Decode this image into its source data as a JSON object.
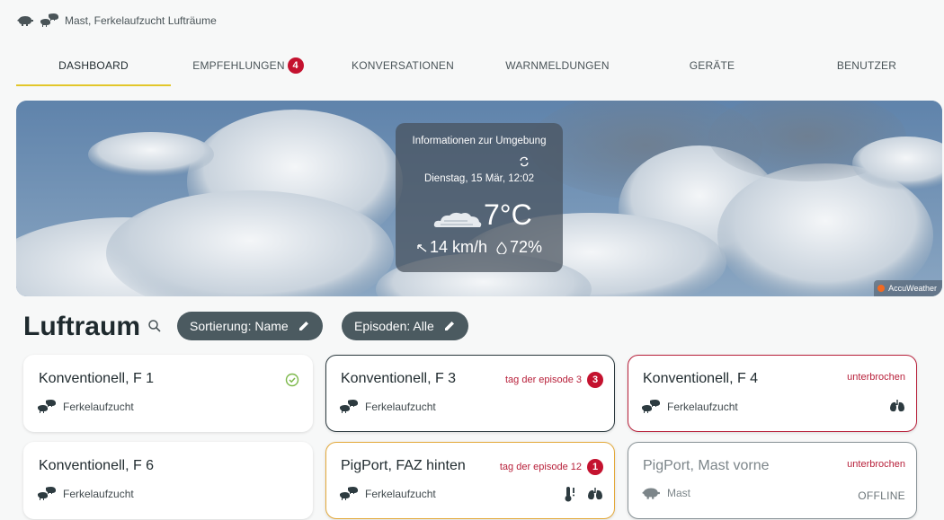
{
  "breadcrumb": {
    "text": "Mast, Ferkelaufzucht Lufträume"
  },
  "tabs": [
    {
      "label": "DASHBOARD",
      "active": true
    },
    {
      "label": "EMPFEHLUNGEN",
      "badge": "4"
    },
    {
      "label": "KONVERSATIONEN"
    },
    {
      "label": "WARNMELDUNGEN"
    },
    {
      "label": "GERÄTE"
    },
    {
      "label": "BENUTZER"
    }
  ],
  "weather": {
    "title": "Informationen zur Umgebung",
    "date": "Dienstag, 15 Mär, 12:02",
    "temperature": "7°C",
    "wind": "14 km/h",
    "humidity": "72%",
    "provider": "AccuWeather"
  },
  "section": {
    "title": "Luftraum",
    "sort_chip": "Sortierung: Name",
    "episode_chip": "Episoden: Alle"
  },
  "cards": [
    {
      "name": "Konventionell, F 1",
      "type": "Ferkelaufzucht"
    },
    {
      "name": "Konventionell, F 3",
      "type": "Ferkelaufzucht",
      "status": "tag der episode 3",
      "badge": "3"
    },
    {
      "name": "Konventionell, F 4",
      "type": "Ferkelaufzucht",
      "status": "unterbrochen"
    },
    {
      "name": "Konventionell, F 6",
      "type": "Ferkelaufzucht"
    },
    {
      "name": "PigPort, FAZ hinten",
      "type": "Ferkelaufzucht",
      "status": "tag der episode 12",
      "badge": "1"
    },
    {
      "name": "PigPort, Mast vorne",
      "type": "Mast",
      "status": "unterbrochen",
      "offline": "OFFLINE"
    }
  ],
  "colors": {
    "accent": "#e2c62a",
    "alert": "#c4122f",
    "chip": "#4b5a60",
    "warning_border": "#e3a93a"
  }
}
